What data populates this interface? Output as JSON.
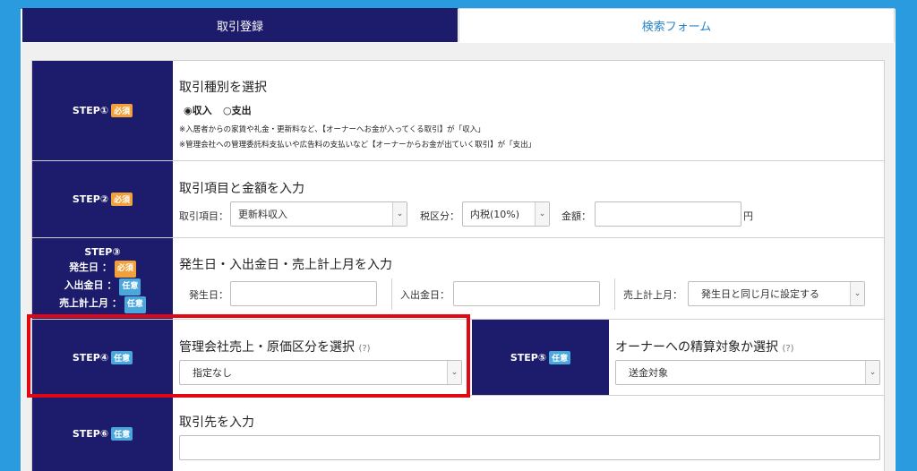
{
  "tabs": [
    {
      "label": "取引登録"
    },
    {
      "label": "検索フォーム"
    }
  ],
  "step1": {
    "step": "STEP①",
    "badge": "必須",
    "title": "取引種別を選択",
    "radios": [
      {
        "symbol": "◉",
        "label": "収入"
      },
      {
        "symbol": "○",
        "label": "支出"
      }
    ],
    "note1": "※入居者からの家賃や礼金・更新料など、【オーナーへお金が入ってくる取引】が「収入」",
    "note2": "※管理会社への管理委託料支払いや広告料の支払いなど【オーナーからお金が出ていく取引】が「支出」"
  },
  "step2": {
    "step": "STEP②",
    "badge": "必須",
    "title": "取引項目と金額を入力",
    "item_label": "取引項目：",
    "item_value": "更新料収入",
    "tax_label": "税区分：",
    "tax_value": "内税(10%)",
    "amount_label": "金額：",
    "amount_value": "",
    "yen": "円"
  },
  "step3": {
    "step": "STEP③",
    "lines": [
      {
        "label": "発生日 ：",
        "badge": "必須"
      },
      {
        "label": "入出金日 ：",
        "badge": "任意"
      },
      {
        "label": "売上計上月 ：",
        "badge": "任意"
      }
    ],
    "title": "発生日・入出金日・売上計上月を入力",
    "occur_label": "発生日：",
    "inout_label": "入出金日：",
    "month_label": "売上計上月：",
    "month_value": "発生日と同じ月に設定する"
  },
  "step4": {
    "step": "STEP④",
    "badge": "任意",
    "title": "管理会社売上・原価区分を選択",
    "help": "(?)",
    "value": "指定なし"
  },
  "step5": {
    "step": "STEP⑤",
    "badge": "任意",
    "title": "オーナーへの精算対象か選択",
    "help": "(?)",
    "value": "送金対象"
  },
  "step6": {
    "step": "STEP⑥",
    "badge": "任意",
    "title": "取引先を入力"
  },
  "colors": {
    "background": "#2b9be0",
    "step_cell": "#1d1b6b",
    "required_badge": "#f2a13a",
    "optional_badge": "#4aa7dc",
    "highlight": "#e30613"
  }
}
